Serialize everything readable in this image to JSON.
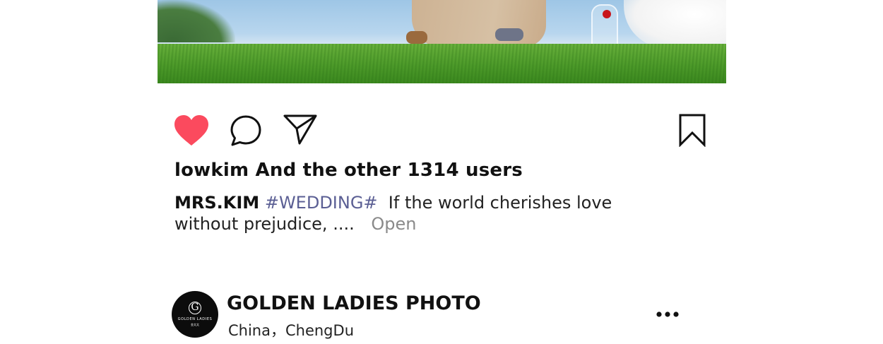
{
  "post": {
    "image_description_icon": "wedding-photo",
    "likes_text": "lowkim And the other 1314 users",
    "caption": {
      "username": "MRS.KIM",
      "hashtag": "#WEDDING#",
      "text": "If the world cherishes love without prejudice, ....",
      "open_label": "Open"
    },
    "actions": {
      "like_icon": "heart-icon",
      "comment_icon": "comment-icon",
      "share_icon": "send-icon",
      "save_icon": "bookmark-icon",
      "liked": true,
      "like_color": "#fb4a5e"
    }
  },
  "next_post": {
    "account_name": "GOLDEN LADIES PHOTO",
    "location": "China，ChengDu",
    "avatar": {
      "monogram": "G",
      "brand_text": "GOLDEN LADIES",
      "sub_text": "金太太"
    },
    "more_icon": "more-options-icon"
  }
}
